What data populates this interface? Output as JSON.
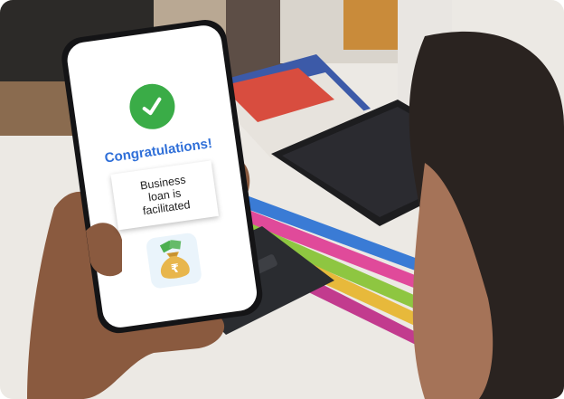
{
  "screen": {
    "title": "Congratulations!",
    "message_lines": [
      "Business",
      "loan is",
      "facilitated"
    ],
    "currency_symbol": "₹"
  },
  "colors": {
    "check": "#3aac47",
    "title": "#2f6fd8",
    "bag": "#e8b64c",
    "notes": "#4caf50"
  },
  "icons": [
    "check-icon",
    "money-bag-icon"
  ]
}
